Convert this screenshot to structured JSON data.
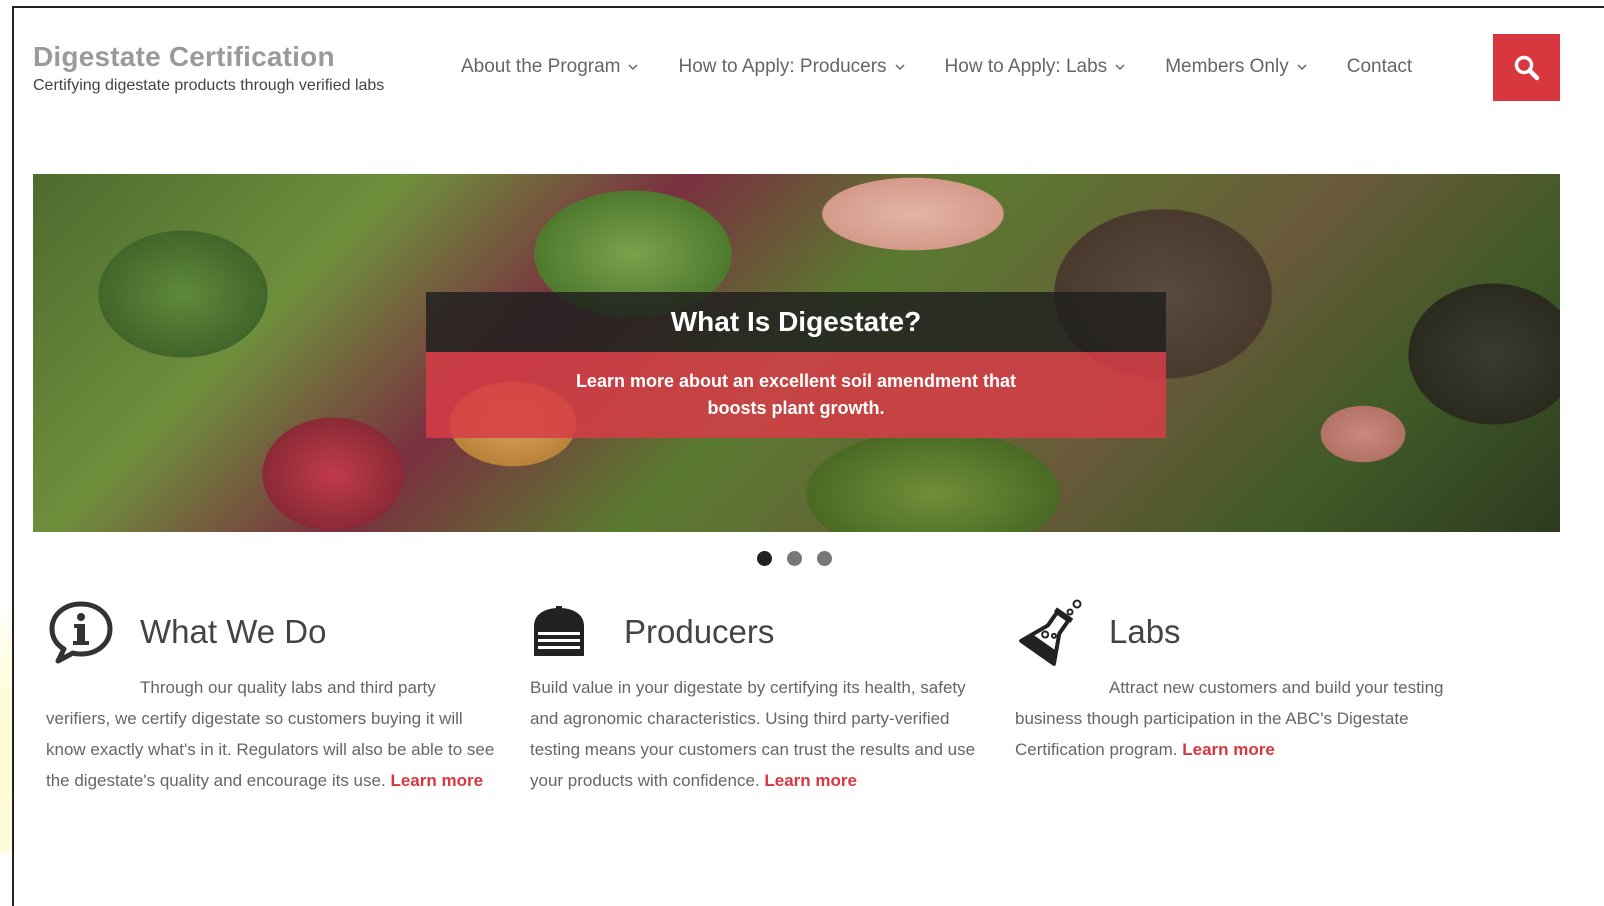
{
  "brand": {
    "title": "Digestate Certification",
    "tagline": "Certifying digestate products through verified labs"
  },
  "nav": {
    "items": [
      {
        "label": "About the Program",
        "has_dropdown": true
      },
      {
        "label": "How to Apply: Producers",
        "has_dropdown": true
      },
      {
        "label": "How to Apply: Labs",
        "has_dropdown": true
      },
      {
        "label": "Members Only",
        "has_dropdown": true
      },
      {
        "label": "Contact",
        "has_dropdown": false
      }
    ],
    "search_icon": "search-icon"
  },
  "hero": {
    "title": "What Is Digestate?",
    "subtitle": "Learn more about an excellent soil amendment that boosts plant growth.",
    "slides": 3,
    "active_slide": 1
  },
  "columns": [
    {
      "icon": "info-bubble-icon",
      "title": "What We Do",
      "body": "Through our quality labs and third party verifiers, we certify digestate so customers buying it will know exactly what's in it. Regulators will also be able to see the digestate's quality and encourage its use.",
      "link": "Learn more"
    },
    {
      "icon": "storage-tank-icon",
      "title": "Producers",
      "body": "Build value in your digestate by certifying its health, safety and agronomic characteristics. Using third party-verified testing means your customers can trust the results and use your products with confidence.",
      "link": "Learn more"
    },
    {
      "icon": "lab-flask-icon",
      "title": "Labs",
      "body": "Attract new customers and build your testing business though participation in the ABC's Digestate Certification program.",
      "link": "Learn more"
    }
  ],
  "colors": {
    "accent": "#d9373f",
    "brand_title": "#9a9a9a",
    "nav_text": "#666666"
  }
}
